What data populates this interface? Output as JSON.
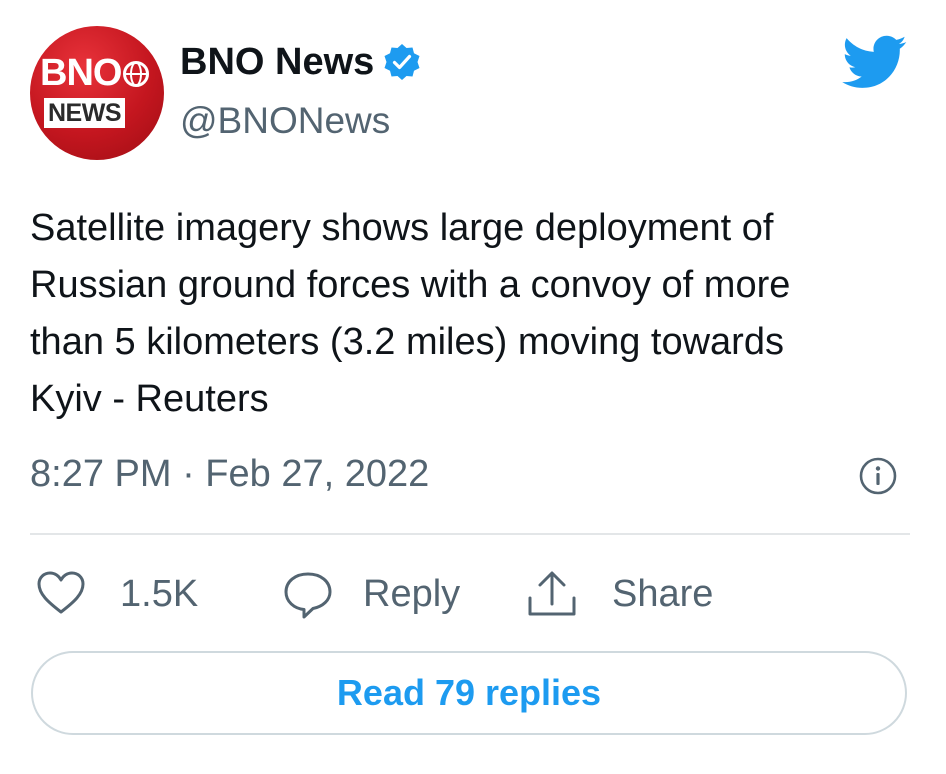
{
  "author": {
    "avatar_logo_line1": "BNO",
    "avatar_logo_line2": "NEWS",
    "name": "BNO News",
    "handle": "@BNONews",
    "verified": true
  },
  "tweet": {
    "text": "Satellite imagery shows large deployment of\nRussian ground forces with a convoy of more\nthan 5 kilometers (3.2 miles) moving towards\nKyiv - Reuters",
    "timestamp": "8:27 PM · Feb 27, 2022"
  },
  "actions": {
    "like_count": "1.5K",
    "reply_label": "Reply",
    "share_label": "Share"
  },
  "read_replies_label": "Read 79 replies",
  "icons": {
    "brand": "twitter-bird-icon",
    "verified": "verified-badge-icon",
    "info": "info-icon",
    "like": "heart-icon",
    "reply": "speech-bubble-icon",
    "share": "share-arrow-icon"
  },
  "colors": {
    "twitter_blue": "#1d9bf0",
    "text_primary": "#0f1419",
    "text_secondary": "#536471",
    "avatar_red": "#c4161f",
    "divider": "#e3e6e8"
  }
}
